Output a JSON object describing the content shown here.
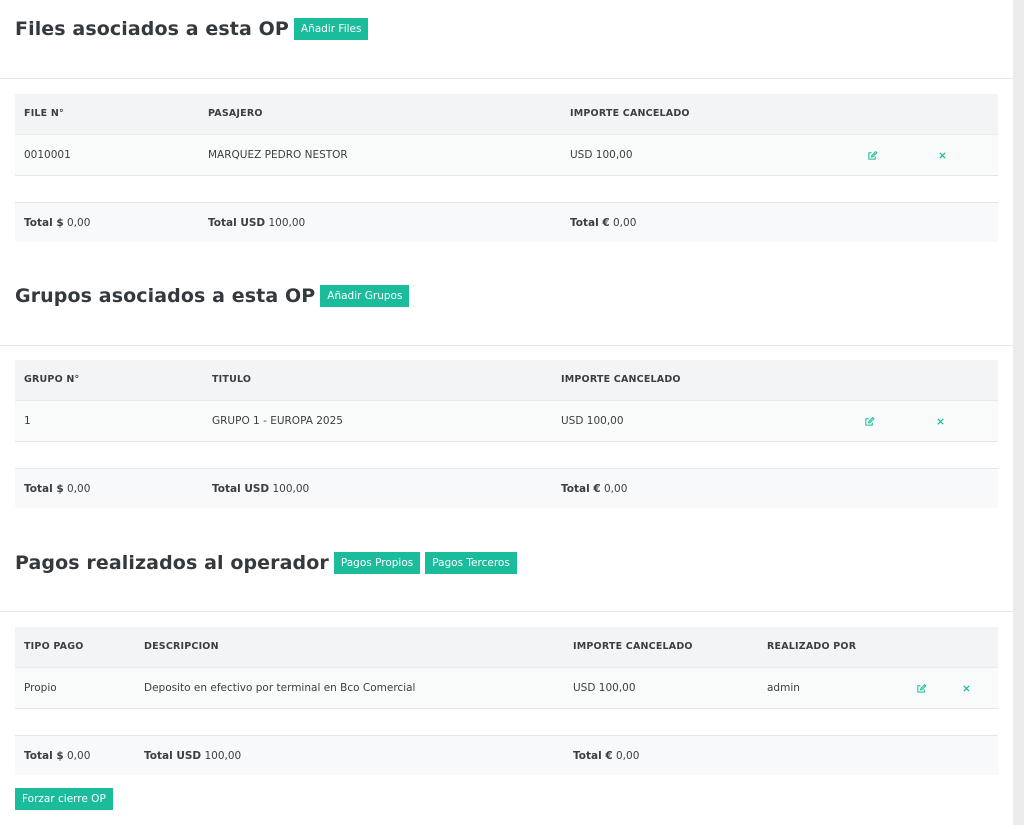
{
  "files": {
    "title": "Files asociados a esta OP",
    "add_button": "Añadir Files",
    "headers": [
      "FILE N°",
      "PASAJERO",
      "IMPORTE CANCELADO"
    ],
    "row": {
      "num": "0010001",
      "name": "MARQUEZ PEDRO NESTOR",
      "amount": "USD 100,00"
    },
    "totals": {
      "ars_label": "Total $",
      "ars_value": "0,00",
      "usd_label": "Total USD",
      "usd_value": "100,00",
      "eur_label": "Total €",
      "eur_value": "0,00"
    }
  },
  "grupos": {
    "title": "Grupos asociados a esta OP",
    "add_button": "Añadir Grupos",
    "headers": [
      "GRUPO N°",
      "TITULO",
      "IMPORTE CANCELADO"
    ],
    "row": {
      "num": "1",
      "name": "GRUPO 1 - EUROPA 2025",
      "amount": "USD 100,00"
    },
    "totals": {
      "ars_label": "Total $",
      "ars_value": "0,00",
      "usd_label": "Total USD",
      "usd_value": "100,00",
      "eur_label": "Total €",
      "eur_value": "0,00"
    }
  },
  "pagos": {
    "title": "Pagos realizados al operador",
    "own_button": "Pagos Propios",
    "third_button": "Pagos Terceros",
    "headers": [
      "TIPO PAGO",
      "DESCRIPCION",
      "IMPORTE CANCELADO",
      "REALIZADO POR"
    ],
    "row": {
      "type": "Propio",
      "description": "Deposito en efectivo por terminal en Bco Comercial",
      "amount": "USD 100,00",
      "by": "admin"
    },
    "totals": {
      "ars_label": "Total $",
      "ars_value": "0,00",
      "usd_label": "Total USD",
      "usd_value": "100,00",
      "eur_label": "Total €",
      "eur_value": "0,00"
    }
  },
  "force_close_button": "Forzar cierre OP",
  "icons": {
    "edit": "edit-icon",
    "delete": "close-icon"
  },
  "colors": {
    "accent": "#1bbc9b",
    "header_bg": "#f2f4f5",
    "row_bg": "#f8fbfa"
  }
}
